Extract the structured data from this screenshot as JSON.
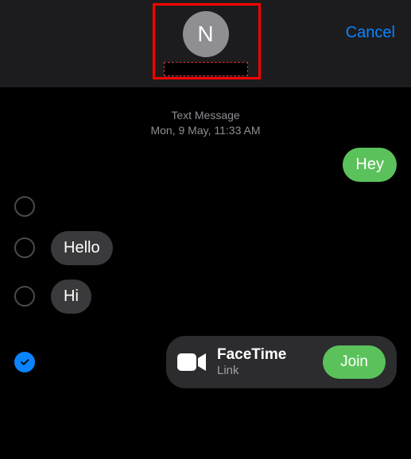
{
  "header": {
    "avatar_initial": "N",
    "cancel_label": "Cancel"
  },
  "timestamp": {
    "label": "Text Message",
    "date": "Mon, 9 May, ",
    "time": "11:33 AM"
  },
  "messages": [
    {
      "side": "right",
      "selectable": false,
      "type": "text",
      "text": "Hey",
      "style": "green"
    },
    {
      "side": "left",
      "selectable": true,
      "selected": false,
      "type": "text",
      "text": "Hello",
      "style": "grey"
    },
    {
      "side": "left",
      "selectable": true,
      "selected": false,
      "type": "text",
      "text": "Hi",
      "style": "grey"
    },
    {
      "side": "right",
      "selectable": true,
      "selected": true,
      "type": "facetime",
      "title": "FaceTime",
      "subtitle": "Link",
      "join_label": "Join"
    }
  ],
  "colors": {
    "accent_blue": "#0a84ff",
    "bubble_green": "#5bc25b",
    "bubble_grey": "#3a3a3c",
    "highlight_red": "#ff0000"
  }
}
